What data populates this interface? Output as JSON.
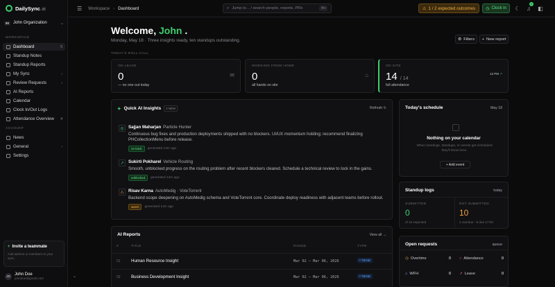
{
  "app": {
    "brand": "DailySync",
    "brand_suffix": ".ai"
  },
  "org": {
    "badge": "80",
    "name": "John Organization"
  },
  "sidebar": {
    "workspace_label": "WORKSPACE",
    "account_label": "ACCOUNT",
    "items": [
      {
        "label": "Dashboard",
        "count": "5",
        "icon": "grid-icon"
      },
      {
        "label": "Standup Notes",
        "count": "",
        "icon": "notes-icon"
      },
      {
        "label": "Standup Reports",
        "count": "",
        "icon": "report-icon"
      },
      {
        "label": "My Sync",
        "count": "›",
        "icon": "sync-icon"
      },
      {
        "label": "Review Requests",
        "count": "›",
        "icon": "review-icon"
      },
      {
        "label": "AI Reports",
        "count": "",
        "icon": "ai-icon"
      },
      {
        "label": "Calendar",
        "count": "",
        "icon": "calendar-icon"
      },
      {
        "label": "Clock In/Out Logs",
        "count": "",
        "icon": "clock-icon"
      },
      {
        "label": "Attendance Overview",
        "count": "4",
        "icon": "attendance-icon"
      }
    ],
    "account_items": [
      {
        "label": "News",
        "icon": "news-icon"
      },
      {
        "label": "General",
        "count": "›",
        "icon": "general-icon"
      },
      {
        "label": "Settings",
        "icon": "gear-icon"
      }
    ],
    "invite": {
      "title": "Invite a teammate",
      "desc": "Add admins or members to your sync."
    },
    "user": {
      "initials": "JD",
      "name": "John Doe",
      "email": "johndoe@gmail.com"
    }
  },
  "topbar": {
    "breadcrumb": [
      "Workspace",
      "Dashboard"
    ],
    "search_placeholder": "Jump to... / search people, reports, PRs",
    "search_kbd": "⌘K",
    "expected": "1 / 2 expected outcomes",
    "clockin": "Clock in",
    "notif_count": "7"
  },
  "welcome": {
    "prefix": "Welcome,",
    "name": "John",
    "suffix": ".",
    "subtitle": "Monday, May 18 · Three insights ready, ten standups outstanding.",
    "filters": "Filters",
    "new_report": "New report",
    "rollcall": "TODAY'S ROLL-CALL"
  },
  "stats": [
    {
      "label": "ON LEAVE",
      "value": "0",
      "note": "— no one out today"
    },
    {
      "label": "WORKING FROM HOME",
      "value": "0",
      "note": "all hands on site"
    },
    {
      "label": "ON SITE",
      "value": "14",
      "value_suffix": "/ 14",
      "note": "full attendance",
      "spark": "12 PM"
    }
  ],
  "insights": {
    "title": "Quick AI Insights",
    "tag": "3 NEW",
    "refresh": "Refresh",
    "items": [
      {
        "name": "Sajjan Maharjan",
        "project": "Particle Hunter",
        "text": "Continuous bug fixes and production deployments shipped with no blockers. UI/UX momentum holding; recommend finalizing PHCollectionMenu before release.",
        "pill": "on track",
        "time": "generated 14m ago",
        "icon": "◎"
      },
      {
        "name": "Sukirti Pokharel",
        "project": "Vehicle Routing",
        "text": "Smooth, unblocked progress on the routing problem after recent blockers cleared. Schedule a technical review to lock in the gains.",
        "pill": "unblocked",
        "time": "generated 14m ago",
        "icon": "↗"
      },
      {
        "name": "Risav Karna",
        "project": "AutoMedig · VoteTorrent",
        "text": "Backend scope deepening on AutoMedig schema and VoteTorrent core. Coordinate deploy readiness with adjacent teams before rollout.",
        "pill": "watch",
        "time": "generated 14m ago",
        "icon": "⚠"
      }
    ]
  },
  "schedule": {
    "title": "Today's schedule",
    "date": "May 18",
    "empty_title": "Nothing on your calendar",
    "empty_desc": "When meetings, standups, or events get scheduled they'll show here.",
    "add_event": "+ Add event"
  },
  "standup_logs": {
    "title": "Standup logs",
    "period": "today",
    "submitted_label": "SUBMITTED",
    "submitted_value": "0",
    "submitted_note": "of 10 expected",
    "not_label": "NOT SUBMITTED",
    "not_value": "10",
    "not_note": "2 overdue · 8 due 17:00"
  },
  "open_requests": {
    "title": "Open requests",
    "tag": "queue",
    "items": [
      {
        "label": "Overtime",
        "count": "0",
        "icon": "overtime-icon",
        "color": "#f0a040"
      },
      {
        "label": "Attendance",
        "count": "0",
        "icon": "attendance-icon",
        "color": "#f06060"
      },
      {
        "label": "WFH",
        "count": "0",
        "icon": "wfh-icon",
        "color": "#6aa8ff"
      },
      {
        "label": "Leave",
        "count": "0",
        "icon": "leave-icon",
        "color": "#f06060"
      }
    ]
  },
  "reports": {
    "title": "AI Reports",
    "view_all": "View all →",
    "columns": [
      "#",
      "TITLE",
      "RANGE",
      "TYPE"
    ],
    "rows": [
      {
        "num": "01",
        "title": "Human Resource Insight",
        "range": "Mar 02 — Mar 06, 2026",
        "type": "• TEAM"
      },
      {
        "num": "02",
        "title": "Business Development Insight",
        "range": "Mar 02 — Mar 06, 2026",
        "type": "• TEAM"
      }
    ]
  }
}
